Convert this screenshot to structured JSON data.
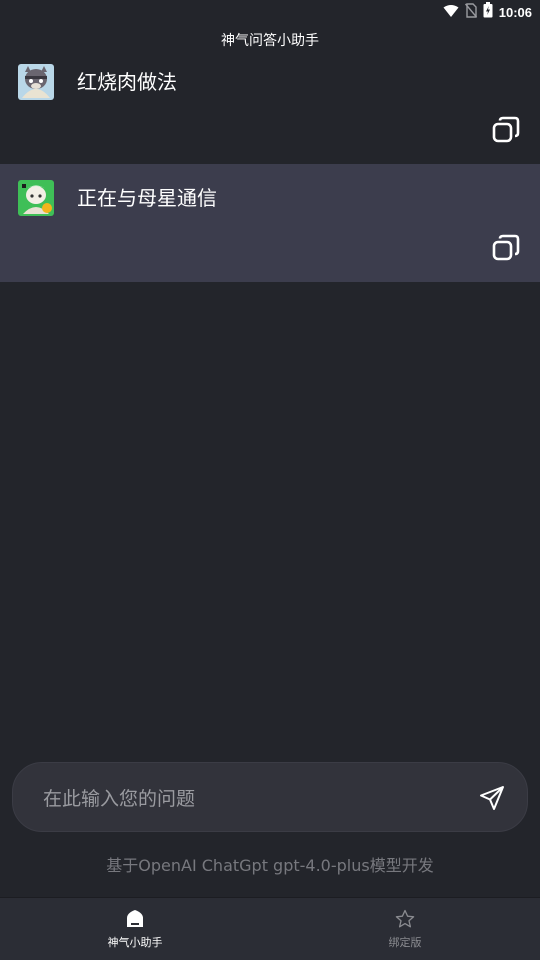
{
  "status_bar": {
    "time": "10:06",
    "icons": [
      "wifi-icon",
      "no-sim-icon",
      "battery-icon"
    ]
  },
  "header": {
    "title": "神气问答小助手"
  },
  "messages": [
    {
      "role": "user",
      "text": "红烧肉做法",
      "avatar": "user-avatar"
    },
    {
      "role": "bot",
      "text": "正在与母星通信",
      "avatar": "bot-avatar"
    }
  ],
  "input": {
    "placeholder": "在此输入您的问题",
    "value": ""
  },
  "footer_note": "基于OpenAI ChatGpt gpt-4.0-plus模型开发",
  "bottom_nav": {
    "items": [
      {
        "label": "神气小助手",
        "icon": "home-icon",
        "active": true
      },
      {
        "label": "绑定版",
        "icon": "star-icon",
        "active": false
      }
    ]
  },
  "colors": {
    "background": "#23252b",
    "bot_message_bg": "#3c3d4d",
    "input_bg": "#32333b",
    "nav_bg": "#2b2d35",
    "muted_text": "#77787e"
  }
}
